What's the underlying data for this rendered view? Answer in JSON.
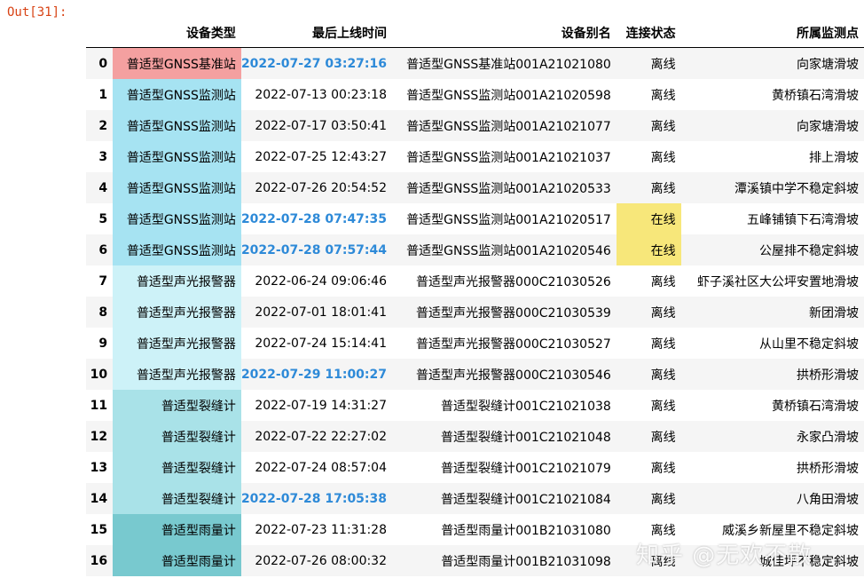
{
  "notebook": {
    "out_prompt": "Out[31]:"
  },
  "table": {
    "headers": [
      "",
      "设备类型",
      "最后上线时间",
      "设备别名",
      "连接状态",
      "所属监测点"
    ],
    "rows": [
      {
        "index": "0",
        "type": "普适型GNSS基准站",
        "time": "2022-07-27 03:27:16",
        "alias": "普适型GNSS基准站001A21021080",
        "status": "离线",
        "site": "向家塘滑坡",
        "type_color": "#f4a0a0",
        "time_highlight": true,
        "status_color": ""
      },
      {
        "index": "1",
        "type": "普适型GNSS监测站",
        "time": "2022-07-13 00:23:18",
        "alias": "普适型GNSS监测站001A21020598",
        "status": "离线",
        "site": "黄桥镇石湾滑坡",
        "type_color": "#a6e3f2",
        "time_highlight": false,
        "status_color": ""
      },
      {
        "index": "2",
        "type": "普适型GNSS监测站",
        "time": "2022-07-17 03:50:41",
        "alias": "普适型GNSS监测站001A21021077",
        "status": "离线",
        "site": "向家塘滑坡",
        "type_color": "#a6e3f2",
        "time_highlight": false,
        "status_color": ""
      },
      {
        "index": "3",
        "type": "普适型GNSS监测站",
        "time": "2022-07-25 12:43:27",
        "alias": "普适型GNSS监测站001A21021037",
        "status": "离线",
        "site": "排上滑坡",
        "type_color": "#a6e3f2",
        "time_highlight": false,
        "status_color": ""
      },
      {
        "index": "4",
        "type": "普适型GNSS监测站",
        "time": "2022-07-26 20:54:52",
        "alias": "普适型GNSS监测站001A21020533",
        "status": "离线",
        "site": "潭溪镇中学不稳定斜坡",
        "type_color": "#a6e3f2",
        "time_highlight": false,
        "status_color": ""
      },
      {
        "index": "5",
        "type": "普适型GNSS监测站",
        "time": "2022-07-28 07:47:35",
        "alias": "普适型GNSS监测站001A21020517",
        "status": "在线",
        "site": "五峰铺镇下石湾滑坡",
        "type_color": "#a6e3f2",
        "time_highlight": true,
        "status_color": "#f7e77a"
      },
      {
        "index": "6",
        "type": "普适型GNSS监测站",
        "time": "2022-07-28 07:57:44",
        "alias": "普适型GNSS监测站001A21020546",
        "status": "在线",
        "site": "公屋排不稳定斜坡",
        "type_color": "#a6e3f2",
        "time_highlight": true,
        "status_color": "#f7e77a"
      },
      {
        "index": "7",
        "type": "普适型声光报警器",
        "time": "2022-06-24 09:06:46",
        "alias": "普适型声光报警器000C21030526",
        "status": "离线",
        "site": "虾子溪社区大公坪安置地滑坡",
        "type_color": "#cdf2f8",
        "time_highlight": false,
        "status_color": ""
      },
      {
        "index": "8",
        "type": "普适型声光报警器",
        "time": "2022-07-01 18:01:41",
        "alias": "普适型声光报警器000C21030539",
        "status": "离线",
        "site": "新团滑坡",
        "type_color": "#cdf2f8",
        "time_highlight": false,
        "status_color": ""
      },
      {
        "index": "9",
        "type": "普适型声光报警器",
        "time": "2022-07-24 15:14:41",
        "alias": "普适型声光报警器000C21030527",
        "status": "离线",
        "site": "从山里不稳定斜坡",
        "type_color": "#cdf2f8",
        "time_highlight": false,
        "status_color": ""
      },
      {
        "index": "10",
        "type": "普适型声光报警器",
        "time": "2022-07-29 11:00:27",
        "alias": "普适型声光报警器000C21030546",
        "status": "离线",
        "site": "拱桥形滑坡",
        "type_color": "#cdf2f8",
        "time_highlight": true,
        "status_color": ""
      },
      {
        "index": "11",
        "type": "普适型裂缝计",
        "time": "2022-07-19 14:31:27",
        "alias": "普适型裂缝计001C21021038",
        "status": "离线",
        "site": "黄桥镇石湾滑坡",
        "type_color": "#a9e2e8",
        "time_highlight": false,
        "status_color": ""
      },
      {
        "index": "12",
        "type": "普适型裂缝计",
        "time": "2022-07-22 22:27:02",
        "alias": "普适型裂缝计001C21021048",
        "status": "离线",
        "site": "永家凸滑坡",
        "type_color": "#a9e2e8",
        "time_highlight": false,
        "status_color": ""
      },
      {
        "index": "13",
        "type": "普适型裂缝计",
        "time": "2022-07-24 08:57:04",
        "alias": "普适型裂缝计001C21021079",
        "status": "离线",
        "site": "拱桥形滑坡",
        "type_color": "#a9e2e8",
        "time_highlight": false,
        "status_color": ""
      },
      {
        "index": "14",
        "type": "普适型裂缝计",
        "time": "2022-07-28 17:05:38",
        "alias": "普适型裂缝计001C21021084",
        "status": "离线",
        "site": "八角田滑坡",
        "type_color": "#a9e2e8",
        "time_highlight": true,
        "status_color": ""
      },
      {
        "index": "15",
        "type": "普适型雨量计",
        "time": "2022-07-23 11:31:28",
        "alias": "普适型雨量计001B21031080",
        "status": "离线",
        "site": "威溪乡新屋里不稳定斜坡",
        "type_color": "#78c9cf",
        "time_highlight": false,
        "status_color": ""
      },
      {
        "index": "16",
        "type": "普适型雨量计",
        "time": "2022-07-26 08:00:32",
        "alias": "普适型雨量计001B21031098",
        "status": "离线",
        "site": "城佳坪不稳定斜坡",
        "type_color": "#78c9cf",
        "time_highlight": false,
        "status_color": ""
      }
    ]
  },
  "watermark": {
    "text": "知乎 @无欢不散"
  }
}
